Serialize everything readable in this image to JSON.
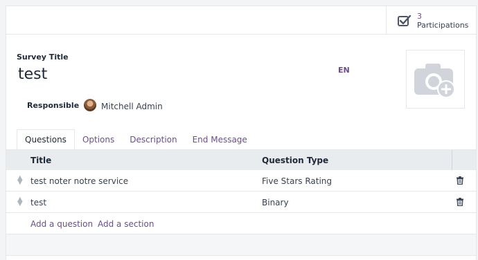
{
  "stat_button": {
    "count": "3",
    "label": "Participations",
    "icon": "checkbox-icon"
  },
  "form": {
    "survey_title_label": "Survey Title",
    "survey_title_value": "test",
    "language_code": "EN",
    "responsible_label": "Responsible",
    "responsible_name": "Mitchell Admin",
    "image_icon": "camera-plus-icon"
  },
  "tabs": [
    {
      "label": "Questions",
      "active": true
    },
    {
      "label": "Options",
      "active": false
    },
    {
      "label": "Description",
      "active": false
    },
    {
      "label": "End Message",
      "active": false
    }
  ],
  "table": {
    "headers": {
      "title": "Title",
      "type": "Question Type"
    },
    "rows": [
      {
        "title": "test noter notre service",
        "type": "Five Stars Rating"
      },
      {
        "title": "test",
        "type": "Binary"
      }
    ],
    "add_question": "Add a question",
    "add_section": "Add a section"
  },
  "colors": {
    "accent": "#6d4c8e",
    "header_bg": "#e9ecef"
  }
}
